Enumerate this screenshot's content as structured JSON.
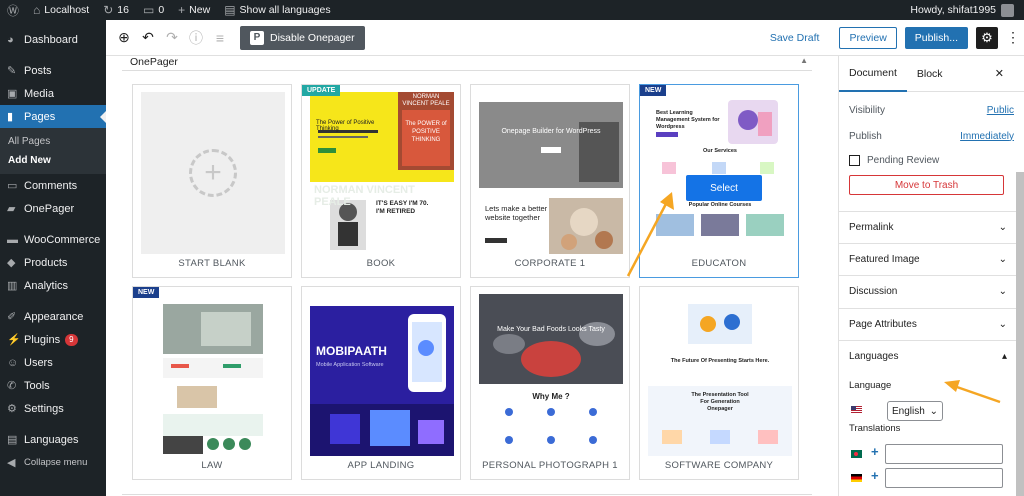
{
  "adminbar": {
    "site_name": "Localhost",
    "updates_count": "16",
    "comments_count": "0",
    "new_label": "New",
    "languages_label": "Show all languages",
    "howdy": "Howdy, shifat1995"
  },
  "sidebar": {
    "dashboard": "Dashboard",
    "posts": "Posts",
    "media": "Media",
    "pages": "Pages",
    "all_pages": "All Pages",
    "add_new": "Add New",
    "comments": "Comments",
    "onepager": "OnePager",
    "woocommerce": "WooCommerce",
    "products": "Products",
    "analytics": "Analytics",
    "appearance": "Appearance",
    "plugins": "Plugins",
    "plugins_badge": "9",
    "users": "Users",
    "tools": "Tools",
    "settings": "Settings",
    "languages": "Languages",
    "collapse": "Collapse menu"
  },
  "toolbar": {
    "disable_onepager": "Disable Onepager",
    "save_draft": "Save Draft",
    "preview": "Preview",
    "publish": "Publish..."
  },
  "content": {
    "heading": "OnePager",
    "select_label": "Select",
    "templates": [
      {
        "name": "START BLANK",
        "tag": ""
      },
      {
        "name": "BOOK",
        "tag": "UPDATE"
      },
      {
        "name": "CORPORATE 1",
        "tag": ""
      },
      {
        "name": "EDUCATON",
        "tag": "NEW"
      },
      {
        "name": "LAW",
        "tag": "NEW"
      },
      {
        "name": "APP LANDING",
        "tag": ""
      },
      {
        "name": "PERSONAL PHOTOGRAPH 1",
        "tag": ""
      },
      {
        "name": "SOFTWARE COMPANY",
        "tag": ""
      }
    ],
    "thumbs": {
      "book_author": "NORMAN VINCENT PEALE",
      "book_title": "The Power of Positive Thinking",
      "book_cover": "The POWER of POSITIVE THINKING",
      "book_bg": "NORMAN VINCENT PEALE",
      "book_quote": "IT'S EASY I'M 70. I'M RETIRED",
      "corp_title": "Onepage Builder for WordPress",
      "corp_tagline": "Lets make a better website together",
      "edu_title": "Best Learning Management System for Wordpress",
      "edu_services": "Our Services",
      "edu_courses": "Popular Online Courses",
      "app_title": "MOBIPAATH",
      "app_sub": "Mobile Application Software",
      "photo_title": "Make Your Bad Foods Looks Tasty",
      "photo_why": "Why Me ?",
      "soft_title": "The Future Of Presenting Starts Here.",
      "soft_tool": "The Presentation Tool For Generation Onepager"
    }
  },
  "panel": {
    "tab_document": "Document",
    "tab_block": "Block",
    "visibility_label": "Visibility",
    "visibility_value": "Public",
    "publish_label": "Publish",
    "publish_value": "Immediately",
    "pending_review": "Pending Review",
    "move_to_trash": "Move to Trash",
    "permalink": "Permalink",
    "featured_image": "Featured Image",
    "discussion": "Discussion",
    "page_attributes": "Page Attributes",
    "languages": "Languages",
    "language_label": "Language",
    "language_value": "English",
    "translations_label": "Translations"
  },
  "colors": {
    "admin_dark": "#1d2327",
    "accent_blue": "#2271b1",
    "arrow_orange": "#f5a623",
    "trash_red": "#d63638"
  }
}
